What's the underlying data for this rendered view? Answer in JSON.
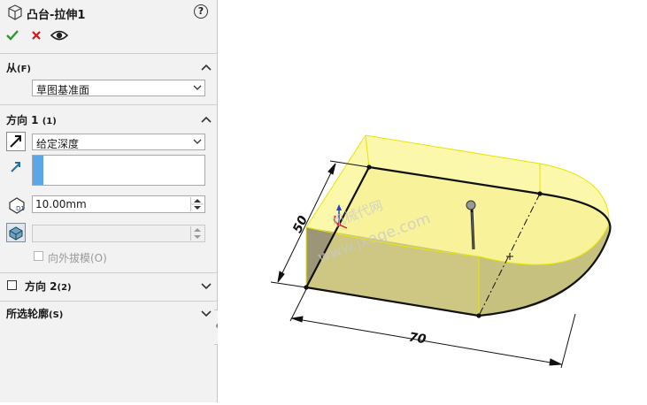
{
  "header": {
    "title": "凸台-拉伸1",
    "help_label": "?"
  },
  "toolbar": {
    "ok_icon": "check-icon",
    "cancel_icon": "close-icon",
    "preview_icon": "eye-icon"
  },
  "from_section": {
    "title": "从",
    "shortcut": "(F)",
    "selected": "草图基准面"
  },
  "direction1": {
    "title": "方向 1",
    "shortcut": "(1)",
    "end_condition": "给定深度",
    "depth_value": "10.00mm",
    "draft_outward_label": "向外拔模(O)"
  },
  "direction2": {
    "title": "方向 2",
    "shortcut": "(2)"
  },
  "selected_contours": {
    "title": "所选轮廓",
    "shortcut": "(S)"
  },
  "viewport": {
    "dim_length": "70",
    "dim_width": "50",
    "watermark": "www.jxage.com",
    "watermark_cn": "机械代网",
    "colors": {
      "preview_fill": "#fbf7a6",
      "preview_edge": "#e6e600",
      "solid_side": "#9c9578",
      "solid_end": "#8d8870",
      "axis_x": "#d62020",
      "axis_y": "#1f3fd6"
    }
  }
}
